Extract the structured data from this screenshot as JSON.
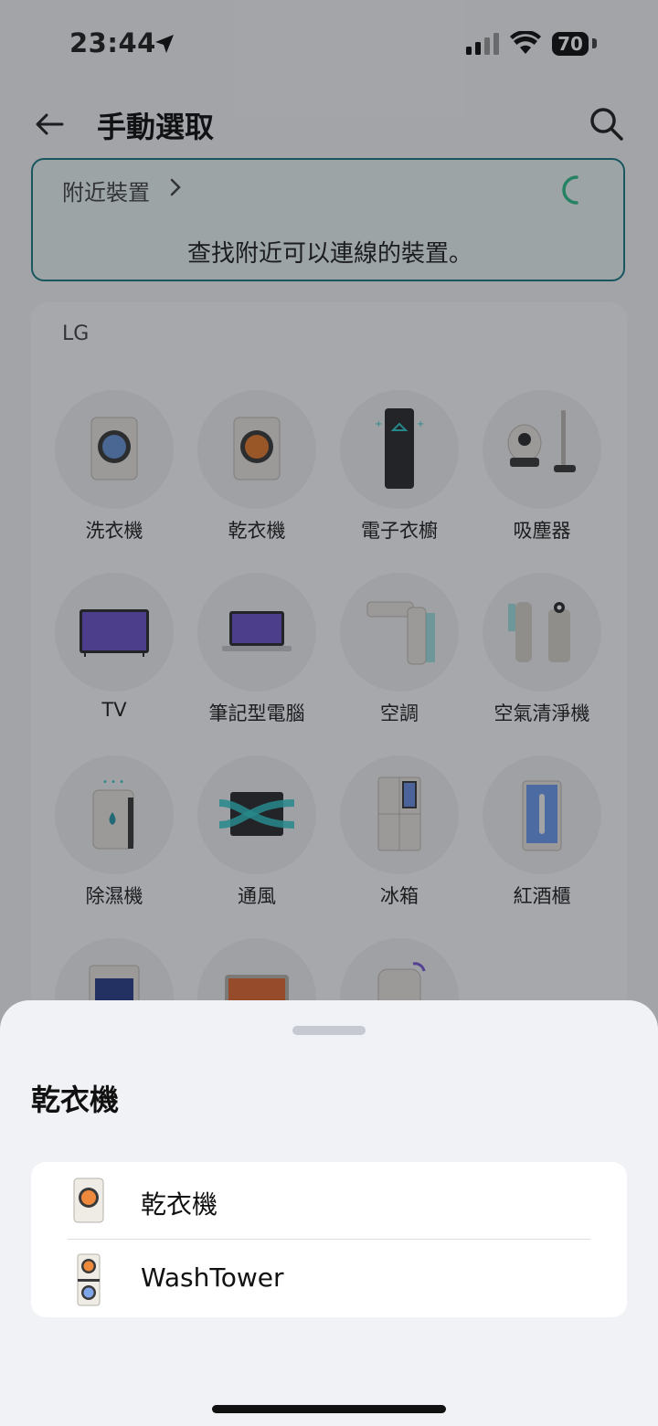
{
  "status": {
    "time": "23:44",
    "battery": "70"
  },
  "header": {
    "title": "手動選取"
  },
  "nearby": {
    "title": "附近裝置",
    "message": "查找附近可以連線的裝置。"
  },
  "lg_section": {
    "label": "LG",
    "devices": [
      {
        "label": "洗衣機",
        "icon": "washer-icon"
      },
      {
        "label": "乾衣機",
        "icon": "dryer-icon"
      },
      {
        "label": "電子衣櫥",
        "icon": "styler-icon"
      },
      {
        "label": "吸塵器",
        "icon": "vacuum-icon"
      },
      {
        "label": "TV",
        "icon": "tv-icon"
      },
      {
        "label": "筆記型電腦",
        "icon": "laptop-icon"
      },
      {
        "label": "空調",
        "icon": "air-conditioner-icon"
      },
      {
        "label": "空氣清淨機",
        "icon": "air-purifier-icon"
      },
      {
        "label": "除濕機",
        "icon": "dehumidifier-icon"
      },
      {
        "label": "通風",
        "icon": "ventilation-icon"
      },
      {
        "label": "冰箱",
        "icon": "refrigerator-icon"
      },
      {
        "label": "紅酒櫃",
        "icon": "wine-cellar-icon"
      }
    ]
  },
  "sheet": {
    "title": "乾衣機",
    "options": [
      {
        "label": "乾衣機",
        "icon": "dryer-icon"
      },
      {
        "label": "WashTower",
        "icon": "washtower-icon"
      }
    ]
  }
}
